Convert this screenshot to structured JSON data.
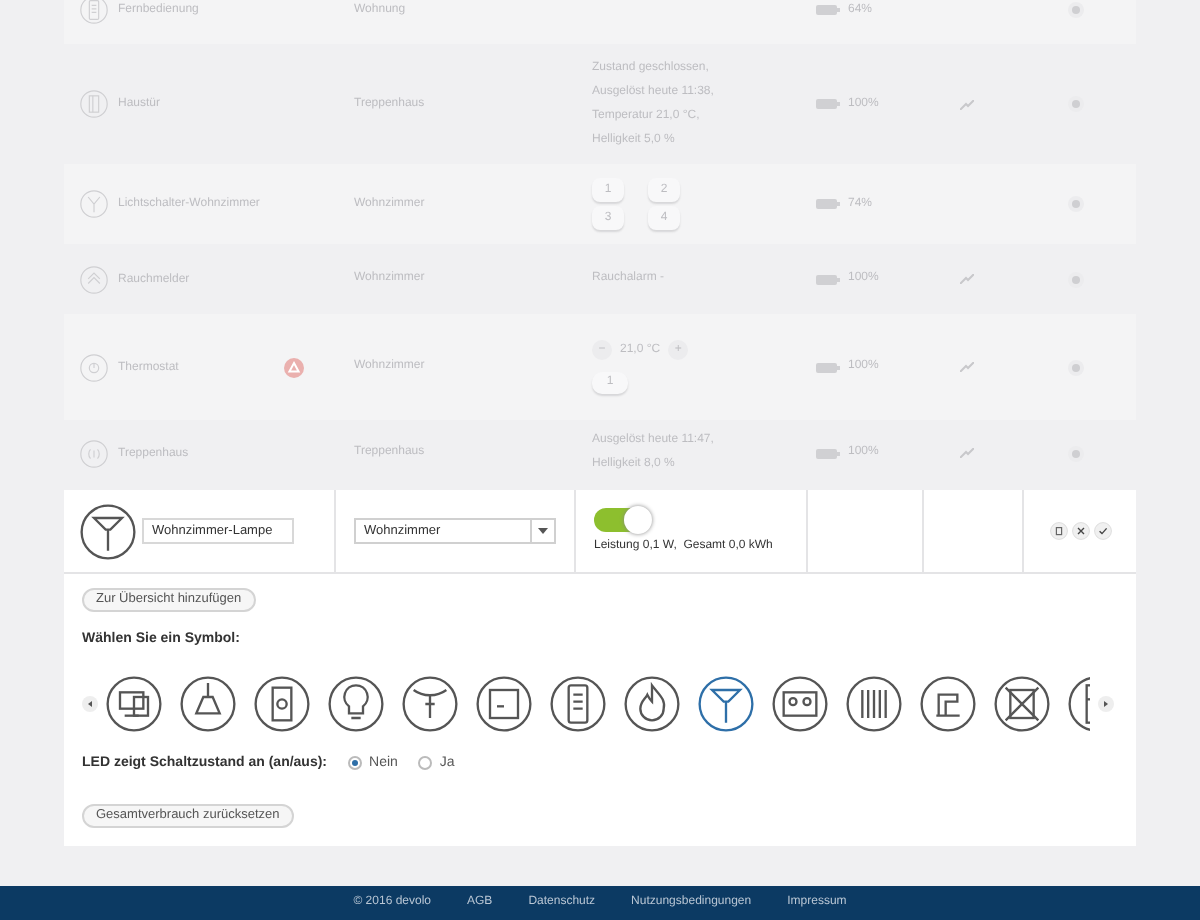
{
  "devices": [
    {
      "kind": "none",
      "name": "Fernbedienung",
      "alert": false,
      "room": "Wohnung",
      "battery": "64%",
      "chart": false
    },
    {
      "kind": "text",
      "name": "Haustür",
      "alert": false,
      "room": "Treppenhaus",
      "status": [
        "Zustand geschlossen,",
        "Ausgelöst heute 11:38,",
        "Temperatur 21,0 °C,",
        "Helligkeit 5,0 %"
      ],
      "battery": "100%",
      "chart": true
    },
    {
      "kind": "keypad",
      "name": "Lichtschalter-Wohnzimmer",
      "alert": false,
      "room": "Wohnzimmer",
      "keys": [
        "1",
        "2",
        "3",
        "4"
      ],
      "battery": "74%",
      "chart": false
    },
    {
      "kind": "text",
      "name": "Rauchmelder",
      "alert": false,
      "room": "Wohnzimmer",
      "status": [
        "Rauchalarm -"
      ],
      "battery": "100%",
      "chart": true
    },
    {
      "kind": "thermostat",
      "name": "Thermostat",
      "alert": true,
      "room": "Wohnzimmer",
      "minus": "−",
      "temperature": "21,0 °C",
      "plus": "+",
      "keys": [
        "1"
      ],
      "battery": "100%",
      "chart": true
    },
    {
      "kind": "text",
      "name": "Treppenhaus",
      "alert": false,
      "room": "Treppenhaus",
      "status": [
        "Ausgelöst heute 11:47,",
        "Helligkeit 8,0 %"
      ],
      "battery": "100%",
      "chart": true
    }
  ],
  "edit": {
    "name_value": "Wohnzimmer-Lampe",
    "room_value": "Wohnzimmer",
    "switch_on": true,
    "reading": "Leistung 0,1 W,  Gesamt 0,0 kWh",
    "add_button": "Zur Übersicht hinzufügen",
    "symbol_heading": "Wählen Sie ein Symbol:",
    "symbols": [
      {
        "kind": "computer",
        "selected": false
      },
      {
        "kind": "pendant",
        "selected": false
      },
      {
        "kind": "socket",
        "selected": false
      },
      {
        "kind": "bulb",
        "selected": false
      },
      {
        "kind": "lights",
        "selected": false
      },
      {
        "kind": "box",
        "selected": false
      },
      {
        "kind": "remote",
        "selected": false
      },
      {
        "kind": "fire",
        "selected": false
      },
      {
        "kind": "ceiling",
        "selected": true
      },
      {
        "kind": "panel",
        "selected": false
      },
      {
        "kind": "radiator",
        "selected": false
      },
      {
        "kind": "kitchen",
        "selected": false
      },
      {
        "kind": "crossed",
        "selected": false
      },
      {
        "kind": "fridge",
        "selected": false
      }
    ],
    "led_label": "LED zeigt Schaltzustand an (an/aus):",
    "led_options": [
      {
        "label": "Nein",
        "selected": true
      },
      {
        "label": "Ja",
        "selected": false
      }
    ],
    "reset_button": "Gesamtverbrauch zurücksetzen"
  },
  "footer": [
    "© 2016 devolo",
    "AGB",
    "Datenschutz",
    "Nutzungsbedingungen",
    "Impressum"
  ]
}
